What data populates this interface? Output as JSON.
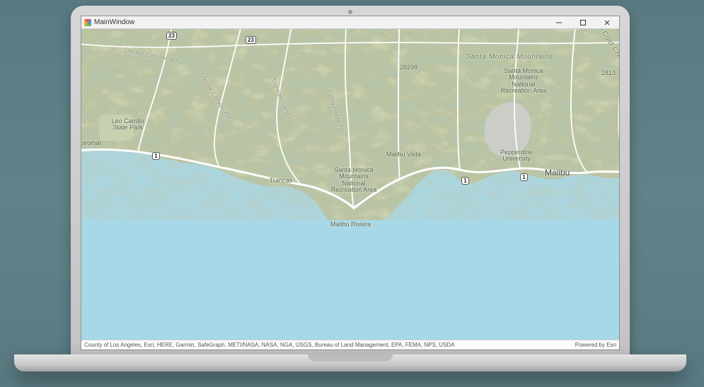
{
  "device": {
    "type": "laptop-mockup"
  },
  "window": {
    "title": "MainWindow",
    "controls": {
      "minimize_tooltip": "Minimize",
      "maximize_tooltip": "Maximize",
      "close_tooltip": "Close"
    }
  },
  "map": {
    "basemap_style": "topographic",
    "labels": {
      "region_italic": "Santa Monica Mountains",
      "peak_28298": "28298",
      "peak_28138": "2813",
      "pepperdine": "Pepperdine\nUniversity",
      "rec_area_east": "Santa Monica\nMountains\nNational\nRecreation Area",
      "rec_area_west": "Santa Monica\nMountains\nNational\nRecreation Area",
      "leo_carrillo": "Leo Carrillo\nState Park",
      "trancas": "Trancas",
      "malibu_vista": "Malibu Vista",
      "malibu": "Malibu",
      "solromar": "olromar",
      "malibu_riviera": "Malibu Riviera",
      "decker_rd": "Decker Canyon Rd",
      "encinal_rd": "Encinal Canyon Rd",
      "trancas_cyn": "Trancas Canyon",
      "zuma_ridge": "Zuma Ridge Trl",
      "cold_creek": "Cold Creek Rd"
    },
    "route_shields": {
      "sr23_a": "23",
      "sr23_b": "23",
      "sr1_a": "1",
      "sr1_b": "1",
      "sr1_c": "1"
    },
    "attribution_left": "County of Los Angeles, Esri, HERE, Garmin, SafeGraph, METI/NASA, NASA, NGA, USGS, Bureau of Land Management, EPA, FEMA, NPS, USDA",
    "attribution_right": "Powered by Esri"
  }
}
